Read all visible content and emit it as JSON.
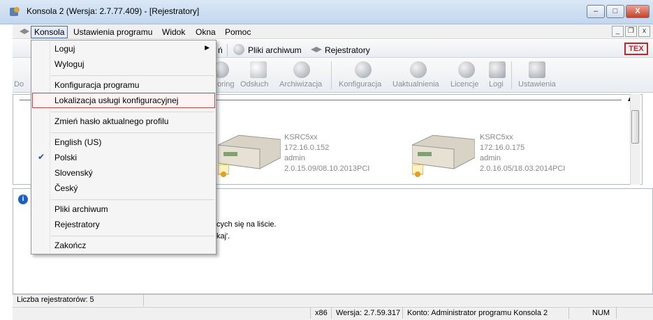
{
  "window": {
    "title": "Konsola 2 (Wersja:  2.7.77.409) - [Rejestratory]",
    "minimize_label": "–",
    "maximize_label": "□",
    "close_label": "X"
  },
  "menubar": {
    "items": [
      "Konsola",
      "Ustawienia programu",
      "Widok",
      "Okna",
      "Pomoc"
    ],
    "mdi_minimize": "_",
    "mdi_restore": "❐",
    "mdi_close": "x"
  },
  "toolbar1": {
    "partial_label": "ń",
    "archive_label": "Pliki archiwum",
    "registrators_label": "Rejestratory",
    "brand_logo": "TEX"
  },
  "toolbar2": {
    "items": [
      "Do",
      "oring",
      "Odsłuch",
      "Archiwizacja",
      "Konfiguracja",
      "Uaktualnienia",
      "Licencje",
      "Logi",
      "Ustawienia"
    ]
  },
  "devices": [
    {
      "name": "KSRC5xx",
      "ip": "172.16.0.152",
      "user": "admin",
      "version": "2.0.15.09/08.10.2013PCI"
    },
    {
      "name": "KSRC5xx",
      "ip": "172.16.0.175",
      "user": "admin",
      "version": "2.0.16.05/18.03.2014PCI"
    }
  ],
  "info": {
    "line1": "cych się na liście.",
    "line2": "kaj'."
  },
  "status": {
    "count": "Liczba rejestratorów: 5",
    "arch": "x86",
    "version": "Wersja: 2.7.59.317",
    "account": "Konto: Administrator programu Konsola 2",
    "num": "NUM"
  },
  "dropdown": {
    "items": [
      {
        "label": "Loguj",
        "submenu": "▶"
      },
      {
        "label": "Wyloguj"
      },
      {
        "label": "Konfiguracja programu"
      },
      {
        "label": "Lokalizacja usługi konfiguracyjnej"
      },
      {
        "label": "Zmień hasło aktualnego profilu"
      },
      {
        "label": "English (US)"
      },
      {
        "label": "Polski",
        "check": "✔"
      },
      {
        "label": "Slovenský"
      },
      {
        "label": "Český"
      },
      {
        "label": "Pliki archiwum"
      },
      {
        "label": "Rejestratory"
      },
      {
        "label": "Zakończ"
      }
    ]
  },
  "colors": {
    "highlight_border": "#c2454b",
    "titlebar": "#c2d7ee"
  }
}
